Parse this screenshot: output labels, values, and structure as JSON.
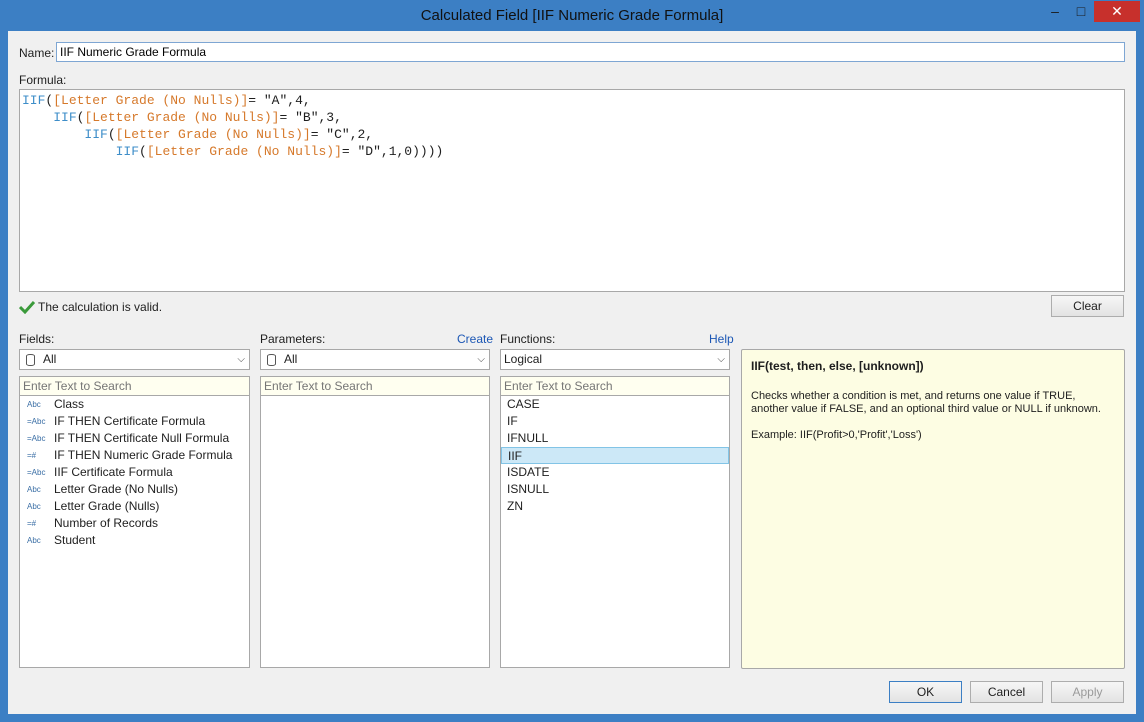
{
  "window": {
    "title": "Calculated Field [IIF Numeric Grade Formula]",
    "minimize_glyph": "–",
    "maximize_glyph": "□",
    "close_glyph": "✕"
  },
  "name": {
    "label": "Name:",
    "value": "IIF Numeric Grade Formula"
  },
  "formula": {
    "label": "Formula:",
    "lines": [
      {
        "indent": "",
        "kw": "IIF",
        "open": "(",
        "field": "[Letter Grade (No Nulls)]",
        "op": "= ",
        "str": "\"A\"",
        "rest": ",4,"
      },
      {
        "indent": "    ",
        "kw": "IIF",
        "open": "(",
        "field": "[Letter Grade (No Nulls)]",
        "op": "= ",
        "str": "\"B\"",
        "rest": ",3,"
      },
      {
        "indent": "        ",
        "kw": "IIF",
        "open": "(",
        "field": "[Letter Grade (No Nulls)]",
        "op": "= ",
        "str": "\"C\"",
        "rest": ",2,"
      },
      {
        "indent": "            ",
        "kw": "IIF",
        "open": "(",
        "field": "[Letter Grade (No Nulls)]",
        "op": "= ",
        "str": "\"D\"",
        "rest": ",1,0))))"
      }
    ]
  },
  "status": {
    "text": "The calculation is valid.",
    "color": "#3a9a3a"
  },
  "clear_label": "Clear",
  "fields": {
    "label": "Fields:",
    "select_value": "All",
    "search_placeholder": "Enter Text to Search",
    "items": [
      {
        "type": "Abc",
        "label": "Class"
      },
      {
        "type": "=Abc",
        "label": "IF THEN Certificate Formula"
      },
      {
        "type": "=Abc",
        "label": "IF THEN Certificate Null Formula"
      },
      {
        "type": "=#",
        "label": "IF THEN Numeric Grade Formula"
      },
      {
        "type": "=Abc",
        "label": "IIF Certificate Formula"
      },
      {
        "type": "Abc",
        "label": "Letter Grade (No Nulls)"
      },
      {
        "type": "Abc",
        "label": "Letter Grade (Nulls)"
      },
      {
        "type": "=#",
        "label": "Number of Records"
      },
      {
        "type": "Abc",
        "label": "Student"
      }
    ]
  },
  "parameters": {
    "label": "Parameters:",
    "create_label": "Create",
    "select_value": "All",
    "search_placeholder": "Enter Text to Search"
  },
  "functions": {
    "label": "Functions:",
    "help_label": "Help",
    "select_value": "Logical",
    "search_placeholder": "Enter Text to Search",
    "items": [
      "CASE",
      "IF",
      "IFNULL",
      "IIF",
      "ISDATE",
      "ISNULL",
      "ZN"
    ],
    "selected": "IIF"
  },
  "help": {
    "title": "IIF(test, then, else, [unknown])",
    "description": "Checks whether a condition is met, and returns one value if TRUE, another value if FALSE, and an optional third value or NULL if unknown.",
    "example": "Example: IIF(Profit>0,'Profit','Loss')"
  },
  "buttons": {
    "ok": "OK",
    "cancel": "Cancel",
    "apply": "Apply"
  }
}
